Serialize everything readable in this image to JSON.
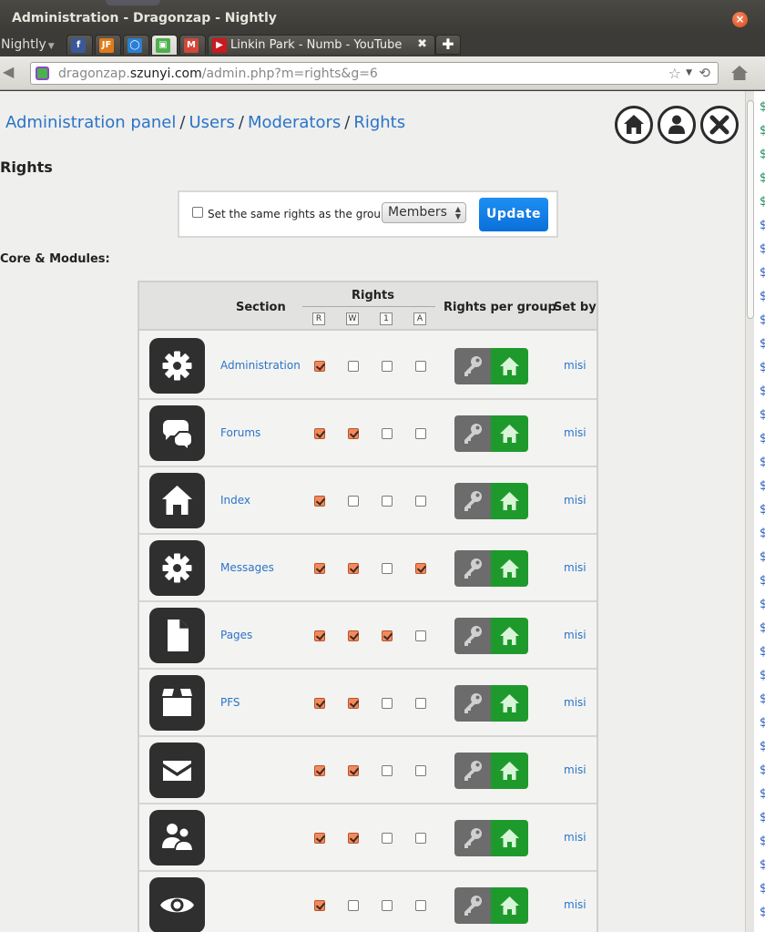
{
  "window": {
    "title": "Administration - Dragonzap - Nightly"
  },
  "browser": {
    "menu_label": "Nightly",
    "tabs": [
      {
        "name": "facebook",
        "icon": "facebook-icon",
        "glyph": "f",
        "color": "#3b5998"
      },
      {
        "name": "jf",
        "icon": "jf-icon",
        "glyph": "JF",
        "color": "#e07a1a"
      },
      {
        "name": "ring",
        "icon": "ring-icon",
        "glyph": "◯",
        "color": "#2a7fd4"
      },
      {
        "name": "dragonzap",
        "icon": "dragonzap-icon",
        "glyph": "▣",
        "color": "#4cb04c"
      },
      {
        "name": "gmail",
        "icon": "gmail-icon",
        "glyph": "M",
        "color": "#d44638"
      },
      {
        "name": "youtube",
        "icon": "youtube-icon",
        "glyph": "▶",
        "color": "#cc181e",
        "label": "Linkin Park - Numb - YouTube"
      }
    ],
    "url": {
      "prefix": "dragonzap.",
      "host": "szunyi.com",
      "path": "/admin.php?m=rights&g=6"
    }
  },
  "breadcrumb": [
    "Administration panel",
    "Users",
    "Moderators",
    "Rights"
  ],
  "page_title": "Rights",
  "same_rights": {
    "label": "Set the same rights as the group:",
    "selected_group": "Members",
    "update_label": "Update"
  },
  "section_title": "Core & Modules:",
  "table": {
    "headers": {
      "section": "Section",
      "rights": "Rights",
      "per_group": "Rights per group",
      "set_by": "Set by"
    },
    "right_columns": [
      "R",
      "W",
      "1",
      "A"
    ],
    "rows": [
      {
        "icon": "gear-icon",
        "section": "Administration",
        "rights": [
          true,
          false,
          false,
          false
        ],
        "set_by": "misi"
      },
      {
        "icon": "chat-bubbles-icon",
        "section": "Forums",
        "rights": [
          true,
          true,
          false,
          false
        ],
        "set_by": "misi"
      },
      {
        "icon": "home-icon",
        "section": "Index",
        "rights": [
          true,
          false,
          false,
          false
        ],
        "set_by": "misi"
      },
      {
        "icon": "gear-icon",
        "section": "Messages",
        "rights": [
          true,
          true,
          false,
          true
        ],
        "set_by": "misi"
      },
      {
        "icon": "page-icon",
        "section": "Pages",
        "rights": [
          true,
          true,
          true,
          false
        ],
        "set_by": "misi"
      },
      {
        "icon": "box-icon",
        "section": "PFS",
        "rights": [
          true,
          true,
          false,
          false
        ],
        "set_by": "misi"
      },
      {
        "icon": "envelope-icon",
        "section": "",
        "rights": [
          true,
          true,
          false,
          false
        ],
        "set_by": "misi"
      },
      {
        "icon": "users-icon",
        "section": "",
        "rights": [
          true,
          true,
          false,
          false
        ],
        "set_by": "misi"
      },
      {
        "icon": "eye-icon",
        "section": "",
        "rights": [
          true,
          false,
          false,
          false
        ],
        "set_by": "misi"
      }
    ]
  },
  "colors": {
    "link": "#2a74c9",
    "update_button": "#0a6fd9",
    "checked": "#f38a5c",
    "group_home": "#1e9a2c",
    "group_key": "#6c6c6c"
  }
}
